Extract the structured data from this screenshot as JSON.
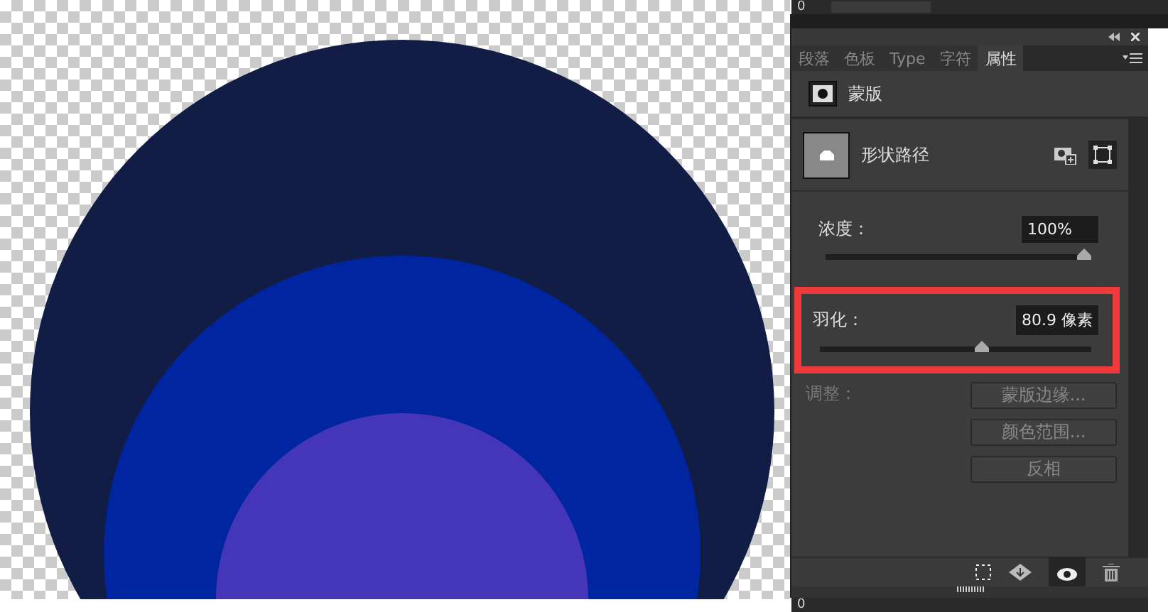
{
  "top_ruler": {
    "label": "0"
  },
  "tabs": [
    {
      "label": "段落",
      "selected": false
    },
    {
      "label": "色板",
      "selected": false
    },
    {
      "label": "Type",
      "selected": false
    },
    {
      "label": "字符",
      "selected": false
    },
    {
      "label": "属性",
      "selected": true
    }
  ],
  "mask": {
    "label": "蒙版"
  },
  "shape_path": {
    "label": "形状路径"
  },
  "sliders": [
    {
      "label": "浓度：",
      "value": "100%",
      "level": 1.0,
      "highlighted": false
    },
    {
      "label": "羽化：",
      "value": "80.9 像素",
      "level": 0.6,
      "highlighted": true
    }
  ],
  "adjust": {
    "label": "调整：",
    "disabled": true,
    "buttons": [
      "蒙版边缘...",
      "颜色范围...",
      "反相"
    ]
  },
  "bottom_ruler": {
    "label": "0"
  }
}
